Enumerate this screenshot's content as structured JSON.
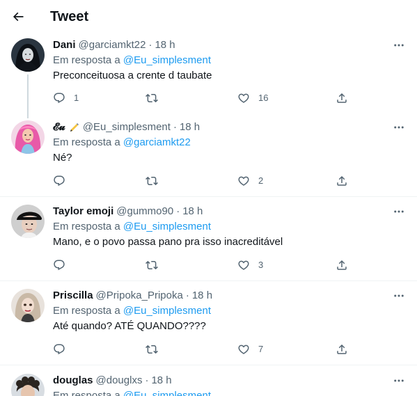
{
  "header": {
    "title": "Tweet"
  },
  "colors": {
    "accent": "#1d9bf0",
    "secondary_text": "#536471",
    "divider": "#eff3f4"
  },
  "tweets": [
    {
      "name": "Dani",
      "handle": "@garciamkt22",
      "dot": "·",
      "time": "18 h",
      "reply_prefix": "Em resposta a",
      "reply_to": "@Eu_simplesment",
      "text": "Preconceituosa a crente d taubate",
      "replies": "1",
      "retweets": "",
      "likes": "16",
      "avatar_icon": "avatar-dark-hair"
    },
    {
      "name": "𝓔𝓾",
      "handle": "@Eu_simplesment",
      "dot": "·",
      "time": "18 h",
      "reply_prefix": "Em resposta a",
      "reply_to": "@garciamkt22",
      "text": "Né?",
      "replies": "",
      "retweets": "",
      "likes": "2",
      "avatar_icon": "avatar-pink-hair",
      "name_emoji": "writing-hand-emoji"
    },
    {
      "name": "Taylor emoji",
      "handle": "@gummo90",
      "dot": "·",
      "time": "18 h",
      "reply_prefix": "Em resposta a",
      "reply_to": "@Eu_simplesment",
      "text": "Mano, e o povo passa pano pra isso inacreditável",
      "replies": "",
      "retweets": "",
      "likes": "3",
      "avatar_icon": "avatar-man-hat"
    },
    {
      "name": "Priscilla",
      "handle": "@Pripoka_Pripoka",
      "dot": "·",
      "time": "18 h",
      "reply_prefix": "Em resposta a",
      "reply_to": "@Eu_simplesment",
      "text": "Até quando? ATÉ QUANDO????",
      "replies": "",
      "retweets": "",
      "likes": "7",
      "avatar_icon": "avatar-doll"
    },
    {
      "name": "douglas",
      "handle": "@douglxs",
      "dot": "·",
      "time": "18 h",
      "reply_prefix": "Em resposta a",
      "reply_to": "@Eu_simplesment",
      "avatar_icon": "avatar-curly-hair"
    }
  ]
}
